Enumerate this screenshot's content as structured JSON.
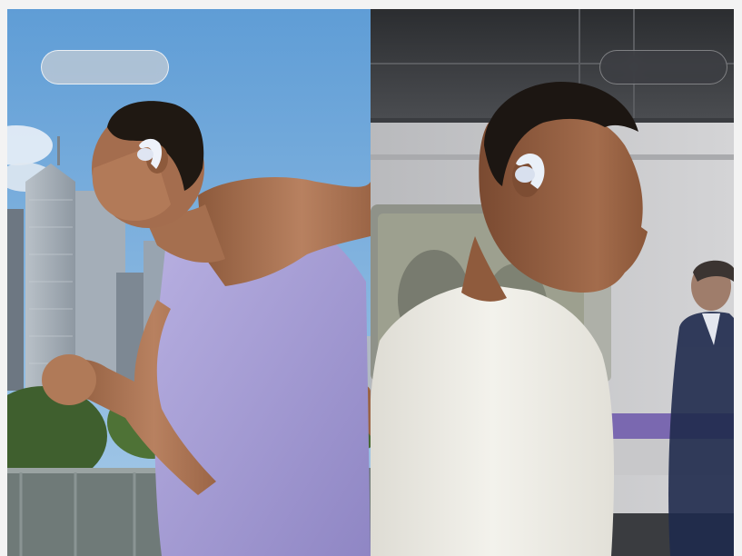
{
  "gallery": {
    "panels": [
      {
        "scene": "outdoor-running",
        "chip_label": "",
        "colors": {
          "sky": "#6fa6d8",
          "tank_top": "#a9a0d6",
          "skin": "#b27a55",
          "earbud": "#e8ecf6"
        }
      },
      {
        "scene": "subway-platform",
        "chip_label": "",
        "colors": {
          "train": "#c9c9cb",
          "stripe": "#7a68b0",
          "sweater": "#efefe9",
          "skin": "#9a6446",
          "earbud": "#dfe6f2"
        }
      }
    ]
  }
}
